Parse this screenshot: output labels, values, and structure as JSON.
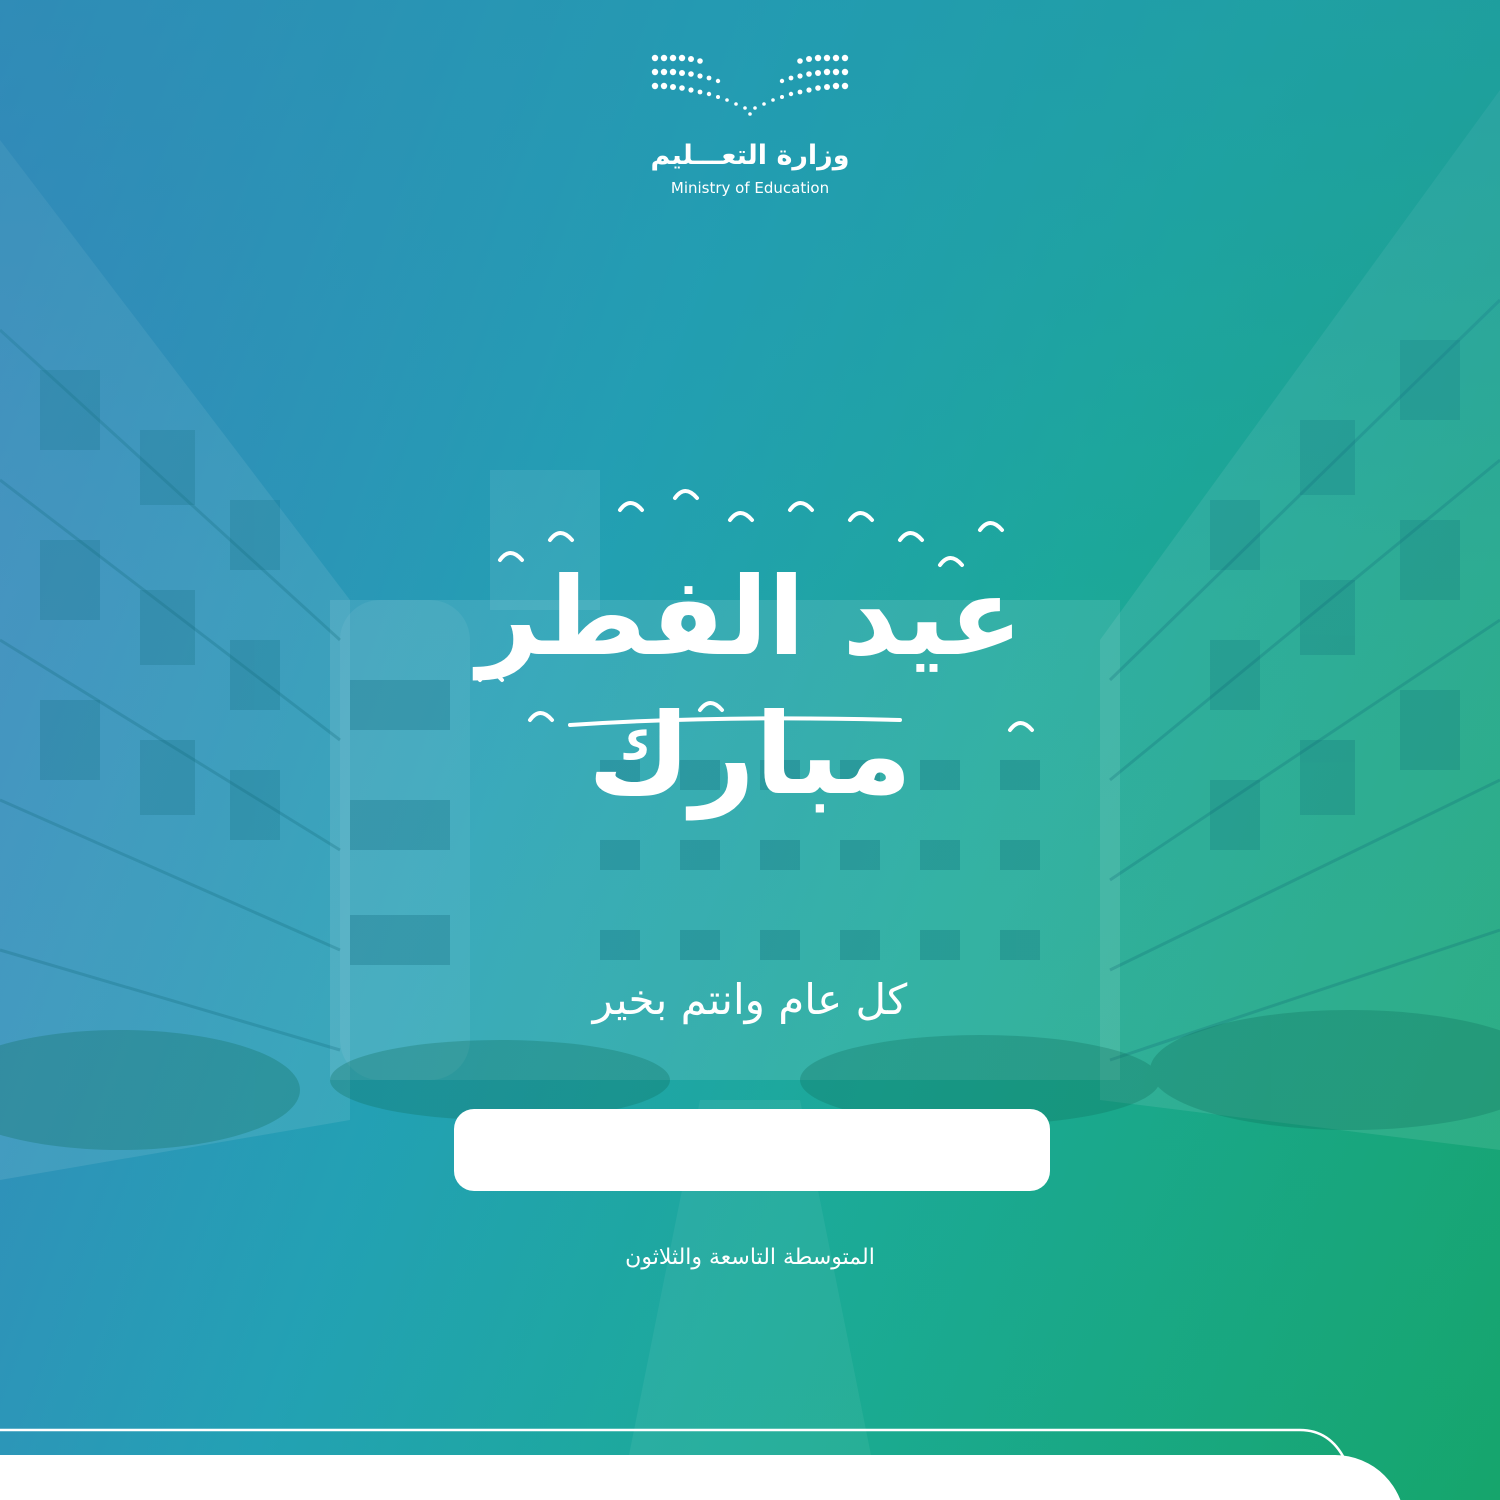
{
  "brand": {
    "name_ar": "وزارة التعـــليم",
    "name_en": "Ministry of Education",
    "logo_icon": "ministry-of-education-dot-logo"
  },
  "title": {
    "line1": "عيد الفطر",
    "line2": "مبارك"
  },
  "greeting": "كل عام وانتم بخير",
  "name_field": {
    "value": ""
  },
  "school_name": "المتوسطة التاسعة والثلاثون",
  "colors": {
    "gradient_start": "#3f7fc0",
    "gradient_mid": "#1bab97",
    "gradient_end": "#16a56c",
    "text": "#ffffff",
    "name_box": "#ffffff"
  }
}
